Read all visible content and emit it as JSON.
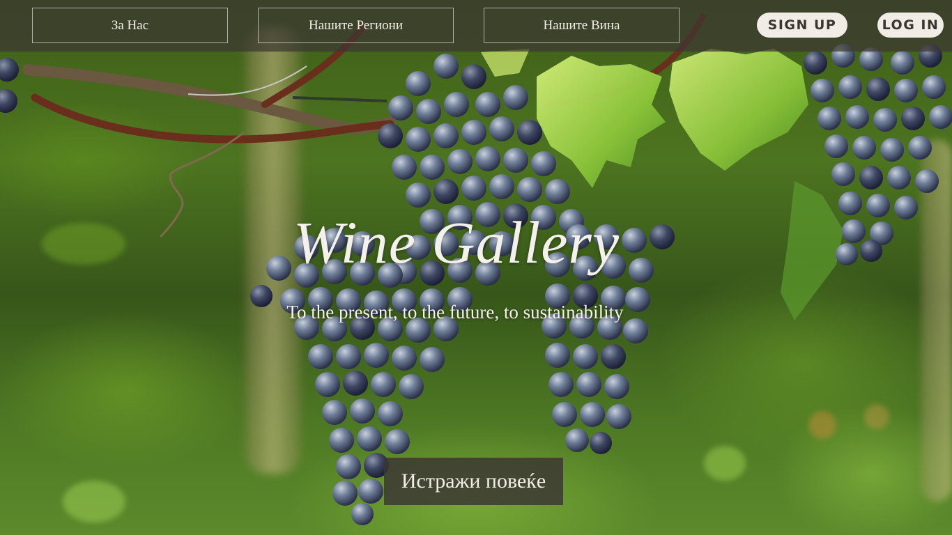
{
  "nav": {
    "links": [
      {
        "label": "За Нас"
      },
      {
        "label": "Нашите Региони"
      },
      {
        "label": "Нашите Вина"
      }
    ],
    "signup_label": "SIGN UP",
    "login_label": "LOG IN"
  },
  "hero": {
    "title": "Wine Gallery",
    "subtitle": "To the present, to the future, to sustainability",
    "cta_label": "Истражи повеќе",
    "background_icon": "grapes-vineyard-photo"
  },
  "colors": {
    "navbar_bg": "#3c3732",
    "pill_bg": "#f1ede6",
    "pill_text": "#3a3530",
    "text_light": "#f4f1ec",
    "cta_bg": "#3c3732"
  }
}
